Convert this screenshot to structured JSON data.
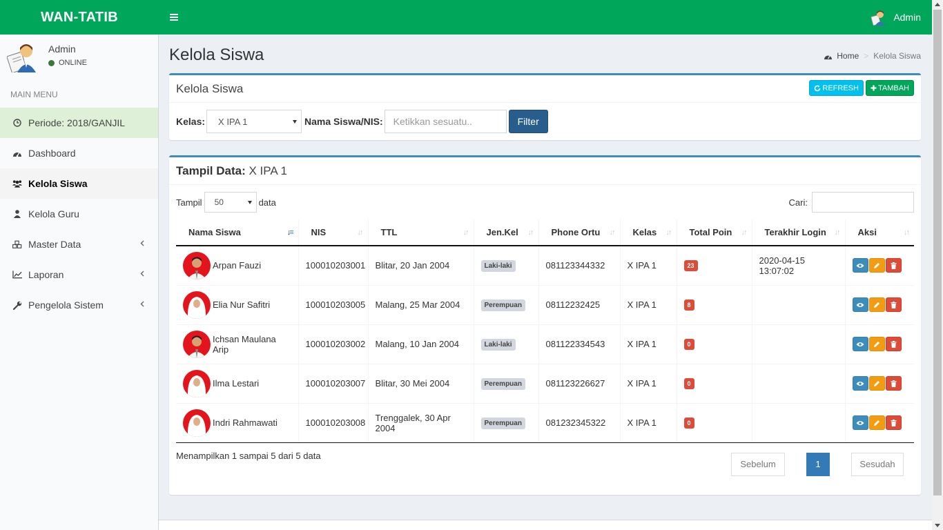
{
  "app": {
    "title": "WAN-TATIB",
    "user": "Admin"
  },
  "sidebar": {
    "user_name": "Admin",
    "status": "ONLINE",
    "menu_header": "MAIN MENU",
    "items": [
      {
        "label": "Periode: 2018/GANJIL",
        "icon": "clock-icon"
      },
      {
        "label": "Dashboard",
        "icon": "dashboard-icon"
      },
      {
        "label": "Kelola Siswa",
        "icon": "users-icon"
      },
      {
        "label": "Kelola Guru",
        "icon": "user-icon"
      },
      {
        "label": "Master Data",
        "icon": "cubes-icon"
      },
      {
        "label": "Laporan",
        "icon": "line-chart-icon"
      },
      {
        "label": "Pengelola Sistem",
        "icon": "wrench-icon"
      }
    ]
  },
  "page": {
    "title": "Kelola Siswa",
    "breadcrumb_home": "Home",
    "breadcrumb_current": "Kelola Siswa"
  },
  "filter_box": {
    "title": "Kelola Siswa",
    "refresh_label": "REFRESH",
    "add_label": "TAMBAH",
    "kelas_label": "Kelas:",
    "kelas_value": "X IPA 1",
    "search_label": "Nama Siswa/NIS:",
    "search_placeholder": "Ketikkan sesuatu..",
    "filter_button": "Filter"
  },
  "data_box": {
    "title_bold": "Tampil Data:",
    "title_value": " X IPA 1",
    "show_label": "Tampil",
    "show_value": "50",
    "show_suffix": "data",
    "search_label": "Cari:",
    "columns": [
      "Nama Siswa",
      "NIS",
      "TTL",
      "Jen.Kel",
      "Phone Ortu",
      "Kelas",
      "Total Poin",
      "Terakhir Login",
      "Aksi"
    ],
    "rows": [
      {
        "name": "Arpan Fauzi",
        "nis": "100010203001",
        "ttl": "Blitar, 20 Jan 2004",
        "gender": "Laki-laki",
        "phone": "081123344332",
        "kelas": "X IPA 1",
        "poin": "23",
        "login": "2020-04-15 13:07:02"
      },
      {
        "name": "Elia Nur Safitri",
        "nis": "100010203005",
        "ttl": "Malang, 25 Mar 2004",
        "gender": "Perempuan",
        "phone": "08112232425",
        "kelas": "X IPA 1",
        "poin": "8",
        "login": ""
      },
      {
        "name": "Ichsan Maulana Arip",
        "nis": "100010203002",
        "ttl": "Malang, 10 Jan 2004",
        "gender": "Laki-laki",
        "phone": "081122334543",
        "kelas": "X IPA 1",
        "poin": "0",
        "login": ""
      },
      {
        "name": "Ilma Lestari",
        "nis": "100010203007",
        "ttl": "Blitar, 30 Mei 2004",
        "gender": "Perempuan",
        "phone": "081123226627",
        "kelas": "X IPA 1",
        "poin": "0",
        "login": ""
      },
      {
        "name": "Indri Rahmawati",
        "nis": "100010203008",
        "ttl": "Trenggalek, 30 Apr 2004",
        "gender": "Perempuan",
        "phone": "081232345322",
        "kelas": "X IPA 1",
        "poin": "0",
        "login": ""
      }
    ],
    "info": "Menampilkan 1 sampai 5 dari 5 data",
    "prev_label": "Sebelum",
    "page": "1",
    "next_label": "Sesudah"
  },
  "colors": {
    "header": "#00a65a",
    "primary": "#3c8dbc",
    "danger": "#dd4b39",
    "warning": "#f39c12",
    "info": "#00c0ef"
  }
}
